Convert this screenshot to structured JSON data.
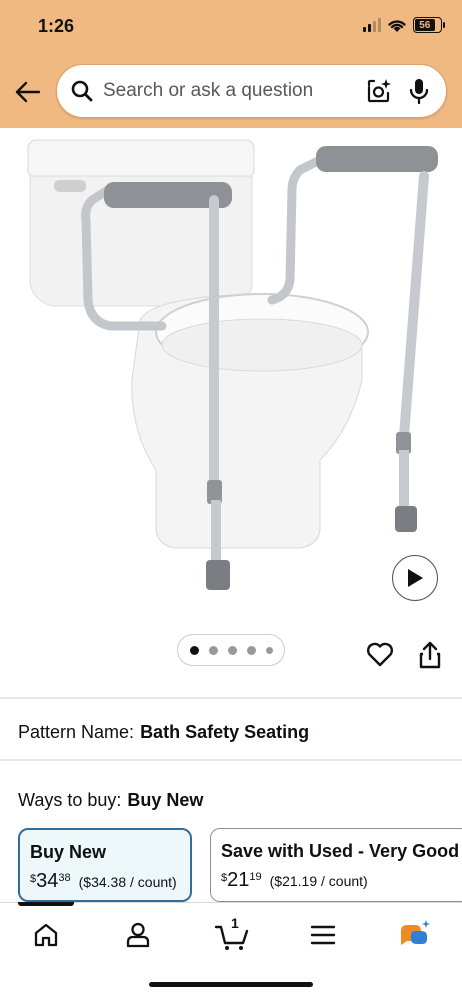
{
  "status": {
    "time": "1:26",
    "battery": "56"
  },
  "search": {
    "placeholder": "Search or ask a question"
  },
  "gallery": {
    "total_images": 5,
    "active_index": 0
  },
  "pattern": {
    "label": "Pattern Name:",
    "value": "Bath Safety Seating"
  },
  "ways_to_buy": {
    "label": "Ways to buy:",
    "value": "Buy New",
    "options": [
      {
        "title": "Buy New",
        "currency": "$",
        "whole": "34",
        "fraction": "38",
        "unit_price": "($34.38 / count)",
        "selected": true
      },
      {
        "title": "Save with Used - Very Good",
        "currency": "$",
        "whole": "21",
        "fraction": "19",
        "unit_price": "($21.19 / count)",
        "selected": false
      }
    ]
  },
  "nav": {
    "cart_count": "1"
  },
  "colors": {
    "header_bg": "#f0b982",
    "selected_border": "#2f6f9e",
    "selected_bg": "#eef8fb"
  }
}
